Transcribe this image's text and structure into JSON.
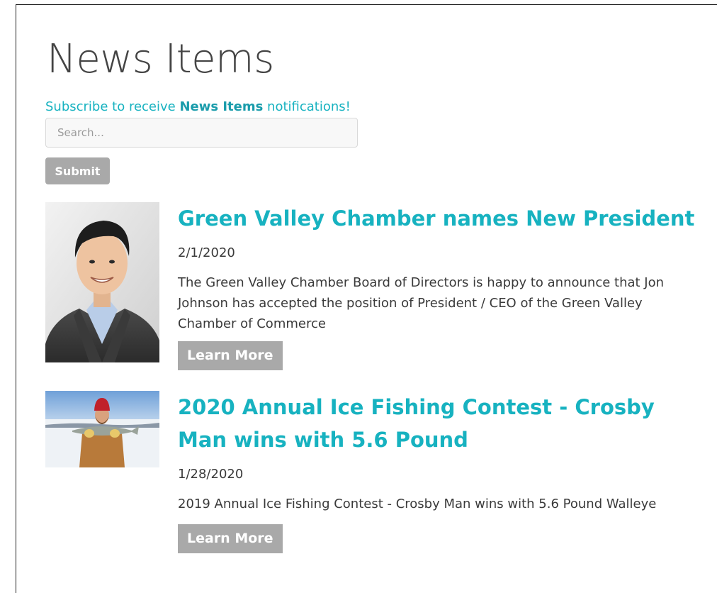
{
  "header": {
    "title": "News Items",
    "subscribe_prefix": "Subscribe to receive ",
    "subscribe_bold": "News Items",
    "subscribe_suffix": " notifications!"
  },
  "search": {
    "placeholder": "Search...",
    "value": "",
    "submit_label": "Submit"
  },
  "news_items": [
    {
      "title": "Green Valley Chamber names New President",
      "date": "2/1/2020",
      "description": "The Green Valley Chamber Board of Directors is happy to announce that Jon Johnson has accepted the position of President / CEO of the Green Valley Chamber of Commerce",
      "button_label": "Learn More"
    },
    {
      "title": "2020 Annual Ice Fishing Contest - Crosby Man wins with 5.6 Pound",
      "date": "1/28/2020",
      "description": "2019 Annual Ice Fishing Contest - Crosby Man wins with 5.6 Pound Walleye",
      "button_label": "Learn More"
    }
  ],
  "colors": {
    "accent": "#17b2c0",
    "button_gray": "#a9a9a9",
    "title_gray": "#444444",
    "text": "#3a3a3a"
  }
}
